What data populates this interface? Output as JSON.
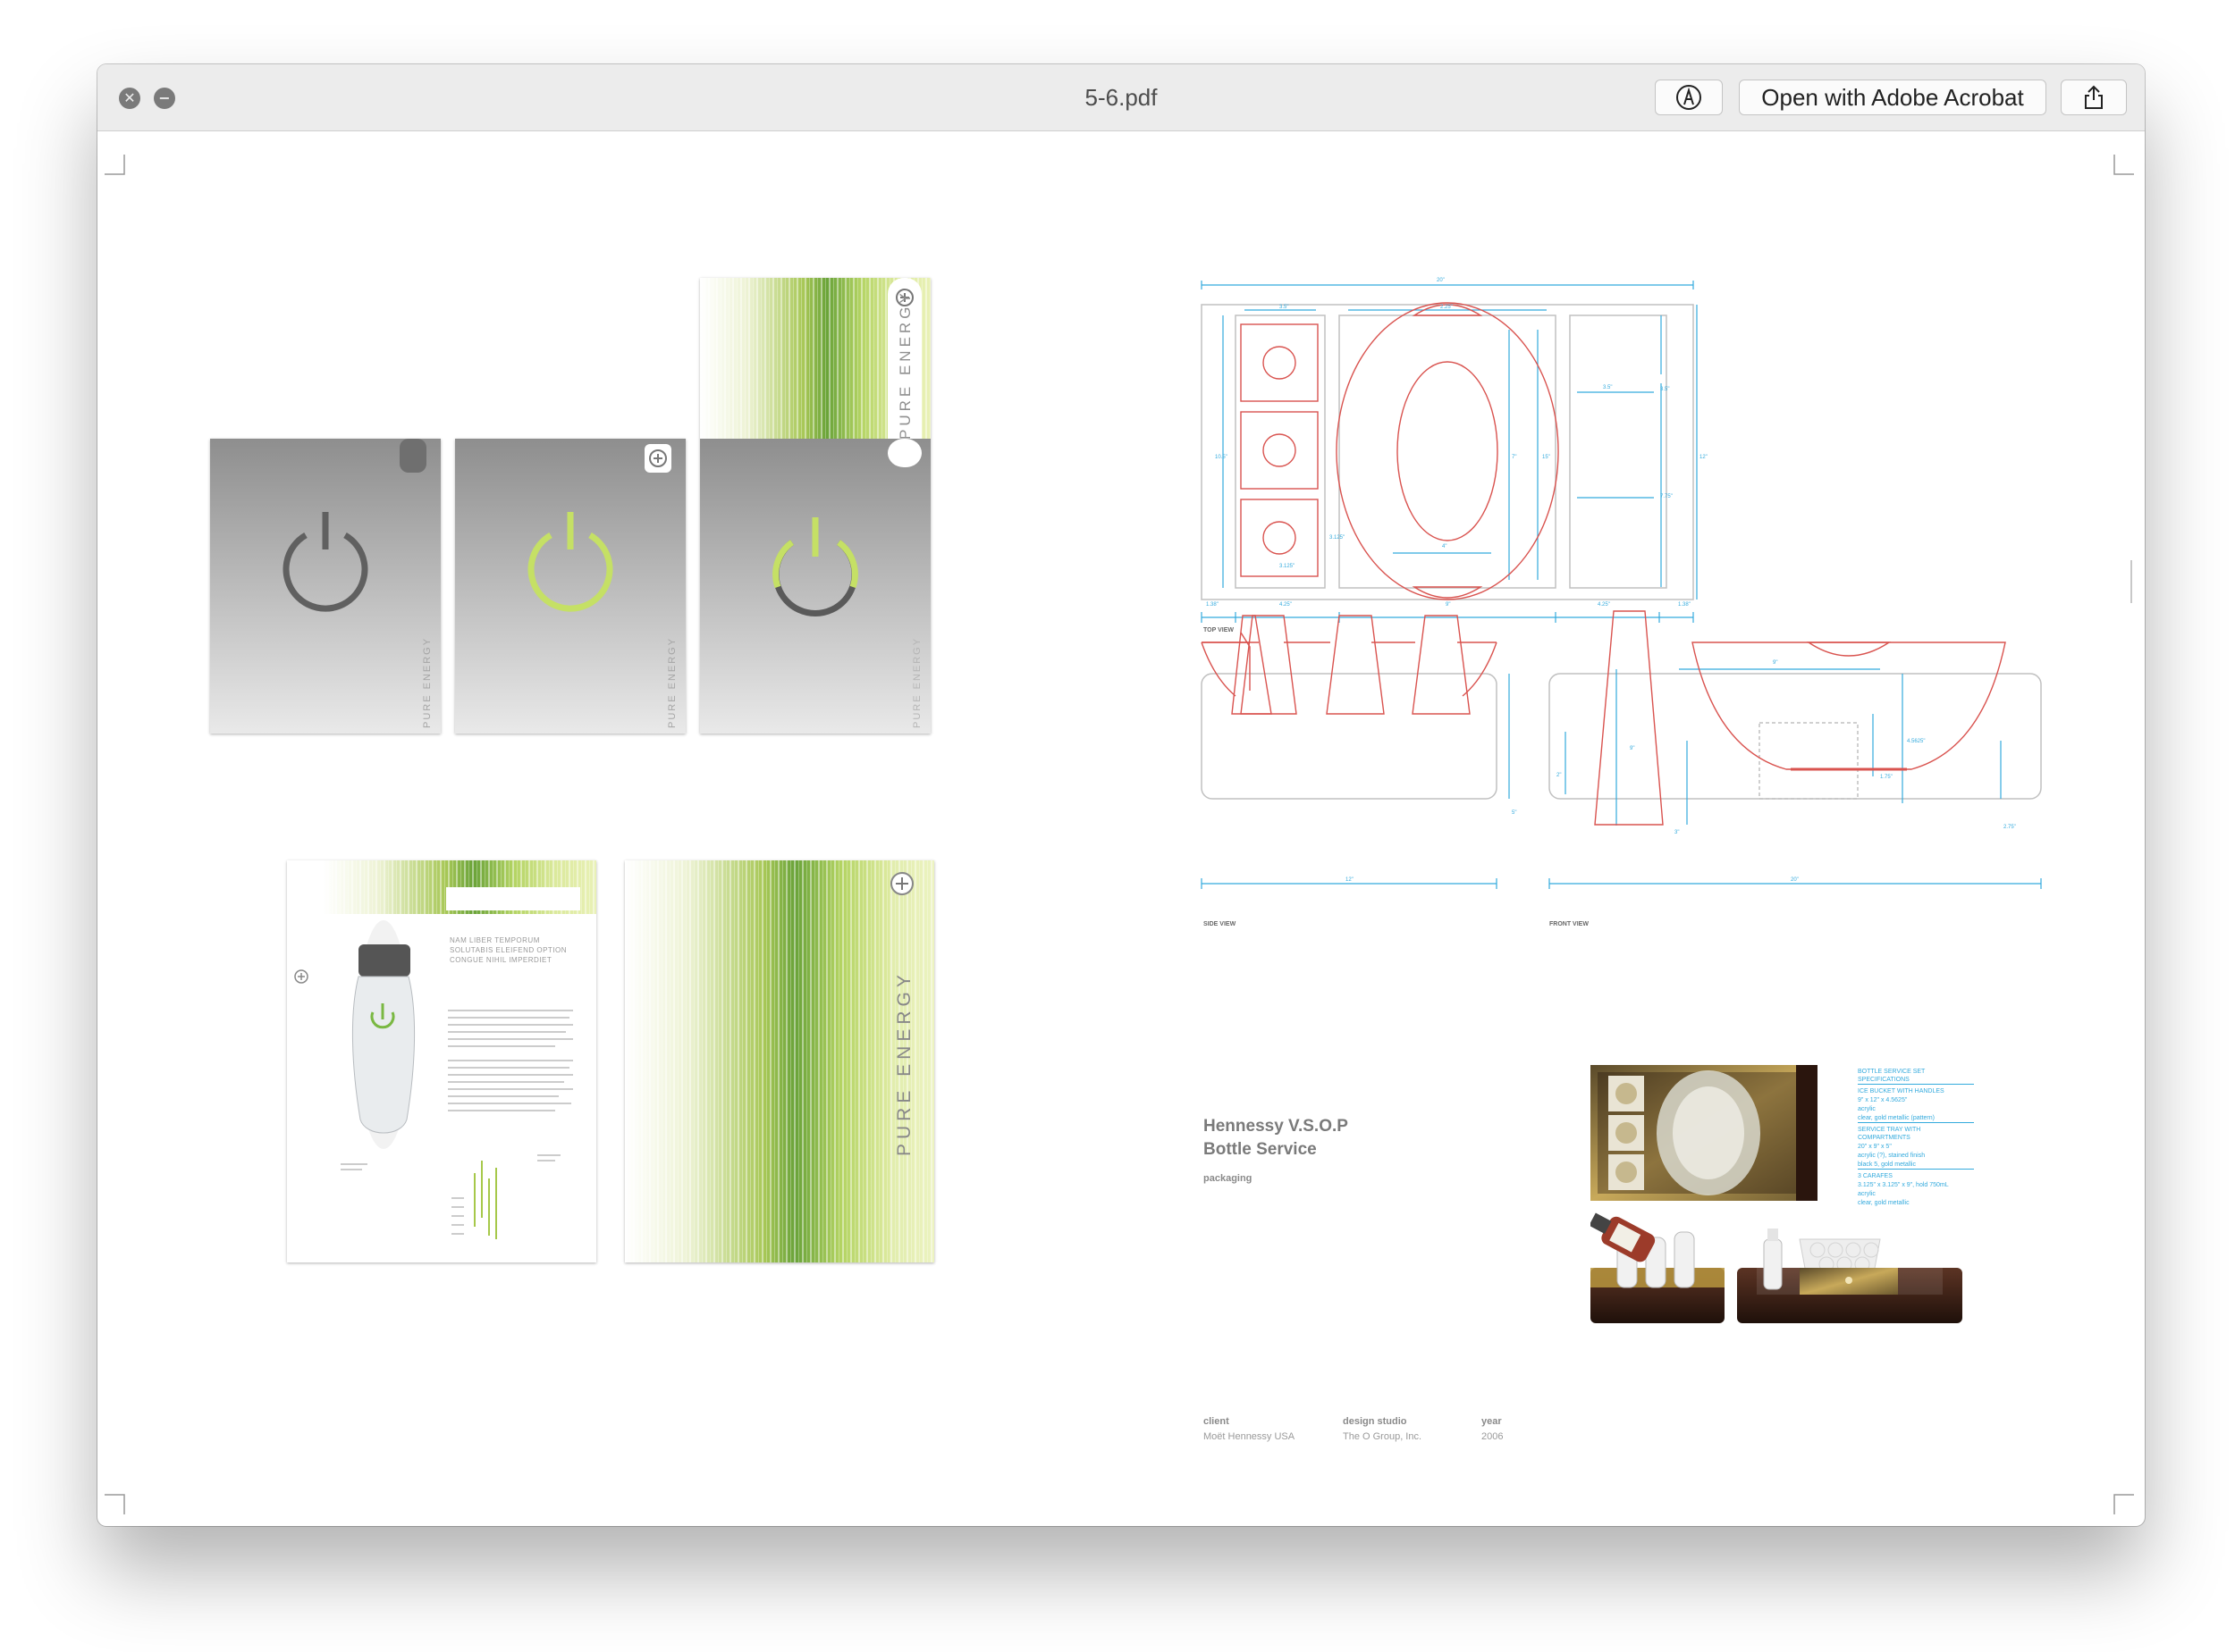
{
  "window": {
    "title": "5-6.pdf",
    "close_glyph": "✕",
    "minimize_glyph": "−",
    "open_button_label": "Open with Adobe Acrobat",
    "markup_icon": "markup-pen-icon",
    "share_icon": "share-icon"
  },
  "cards": {
    "power_brand": "PURE ENERGY",
    "brochure_heading": "NAM LIBER TEMPORUM SOLUTABIS ELEIFEND OPTION CONGUE NIHIL IMPERDIET",
    "bottle_brand": "PURE ENERGY"
  },
  "drawing": {
    "top_view_label": "TOP VIEW",
    "side_view_label": "SIDE VIEW",
    "front_view_label": "FRONT VIEW",
    "dims": {
      "total_width": "20\"",
      "d1": "3.5\"",
      "d2": "2.25\"",
      "d3": "3.5\"",
      "d4": "3.5\"",
      "h_left": "10.5\"",
      "h_mid": "7\"",
      "h_oval": "15\"",
      "h_right": "12\"",
      "w_inner": "4\"",
      "d5": "3.125\"",
      "d6": "3.125\"",
      "d7": "7.75\"",
      "b1": "1.38\"",
      "b2": "4.25\"",
      "b3": "9\"",
      "b4": "4.25\"",
      "b5": "1.38\"",
      "side_width": "12\"",
      "side_height": "5\"",
      "front_top": "9\"",
      "front_width": "20\"",
      "f1": "4.5625\"",
      "f2": "1.75\"",
      "f3": "2\"",
      "f4": "9\"",
      "f5": "3\"",
      "f6": "2.75\""
    }
  },
  "project": {
    "title_line1": "Hennessy V.S.O.P",
    "title_line2": "Bottle Service",
    "category": "packaging",
    "client_label": "client",
    "client_value": "Moët Hennessy USA",
    "studio_label": "design studio",
    "studio_value": "The O Group, Inc.",
    "year_label": "year",
    "year_value": "2006"
  },
  "specs": {
    "heading": "BOTTLE SERVICE SET SPECIFICATIONS",
    "item1_title": "ICE BUCKET WITH HANDLES",
    "item1_dims": "9\" x 12\" x 4.5625\"",
    "item1_mat": "acrylic",
    "item1_finish": "clear, gold metallic (pattern)",
    "item2_title": "SERVICE TRAY WITH COMPARTMENTS",
    "item2_dims": "20\" x 9\" x 5\"",
    "item2_mat": "acrylic (?), stained finish",
    "item2_finish": "black 5, gold metallic",
    "item3_title": "3 CARAFES",
    "item3_dims": "3.125\" x 3.125\" x 9\", hold 750mL",
    "item3_mat": "acrylic",
    "item3_finish": "clear, gold metallic"
  },
  "colors": {
    "titlebar": "#ececec",
    "cyan_dim": "#33aadd",
    "red_line": "#d9534f",
    "green_accent": "#a9c94a",
    "gold": "#b89a4c",
    "dark_brown": "#2e1a12"
  }
}
